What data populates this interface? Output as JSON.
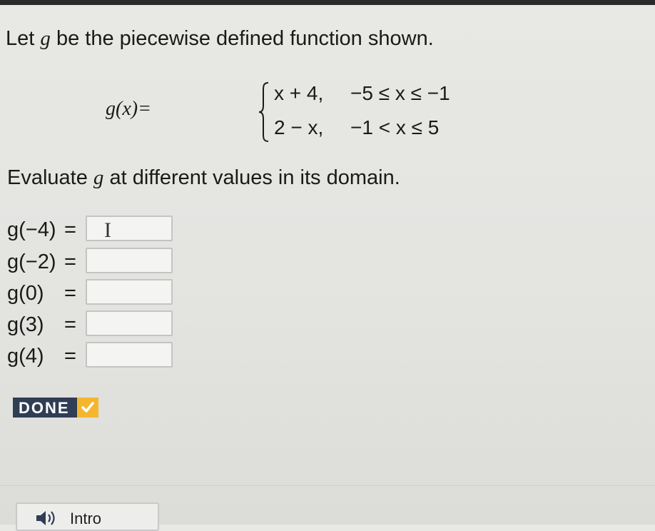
{
  "prompt": {
    "part1": "Let",
    "var": "g",
    "part2": "be the piecewise defined function shown."
  },
  "function": {
    "lhs": "g(x)=",
    "cases": [
      {
        "expr": "x + 4,",
        "cond": "−5 ≤ x ≤ −1"
      },
      {
        "expr": "2 − x,",
        "cond": "−1 < x ≤ 5"
      }
    ]
  },
  "instruction": {
    "part1": "Evaluate",
    "var": "g",
    "part2": "at different values in its domain."
  },
  "evaluations": [
    {
      "label": "g(−4)",
      "eq": "=",
      "value": ""
    },
    {
      "label": "g(−2)",
      "eq": "=",
      "value": ""
    },
    {
      "label": "g(0)",
      "eq": "=",
      "value": ""
    },
    {
      "label": "g(3)",
      "eq": "=",
      "value": ""
    },
    {
      "label": "g(4)",
      "eq": "=",
      "value": ""
    }
  ],
  "done_button": {
    "label": "DONE",
    "icon": "check-icon"
  },
  "intro_button": {
    "label": "Intro",
    "icon": "speaker-icon"
  },
  "colors": {
    "done_bg": "#2f3d55",
    "done_check": "#f3b62d"
  }
}
